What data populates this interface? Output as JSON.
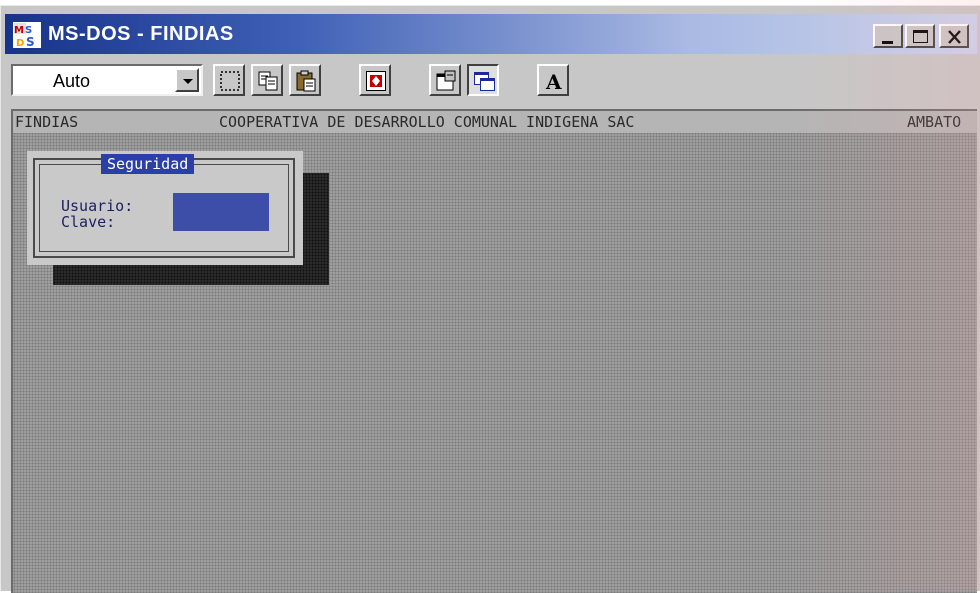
{
  "window": {
    "title": "MS-DOS - FINDIAS",
    "icon": "ms-dos-icon",
    "controls": [
      "minimize-icon",
      "maximize-icon",
      "close-icon"
    ]
  },
  "toolbar": {
    "font_size_value": "Auto",
    "buttons": [
      "mark-icon",
      "copy-icon",
      "paste-icon",
      "full-screen-icon",
      "properties-icon",
      "background-icon",
      "font-icon"
    ]
  },
  "screen": {
    "status": {
      "left": "FINDIAS",
      "center": "COOPERATIVA DE DESARROLLO COMUNAL INDIGENA SAC",
      "right": "AMBATO"
    },
    "dialog": {
      "title": "Seguridad",
      "user_label": "Usuario:",
      "password_label": "Clave:",
      "user_value": ""
    }
  },
  "colors": {
    "title_gradient_start": "#17338a",
    "dialog_title_bg": "#2b3fa8",
    "input_bg": "#3d4ea8"
  }
}
